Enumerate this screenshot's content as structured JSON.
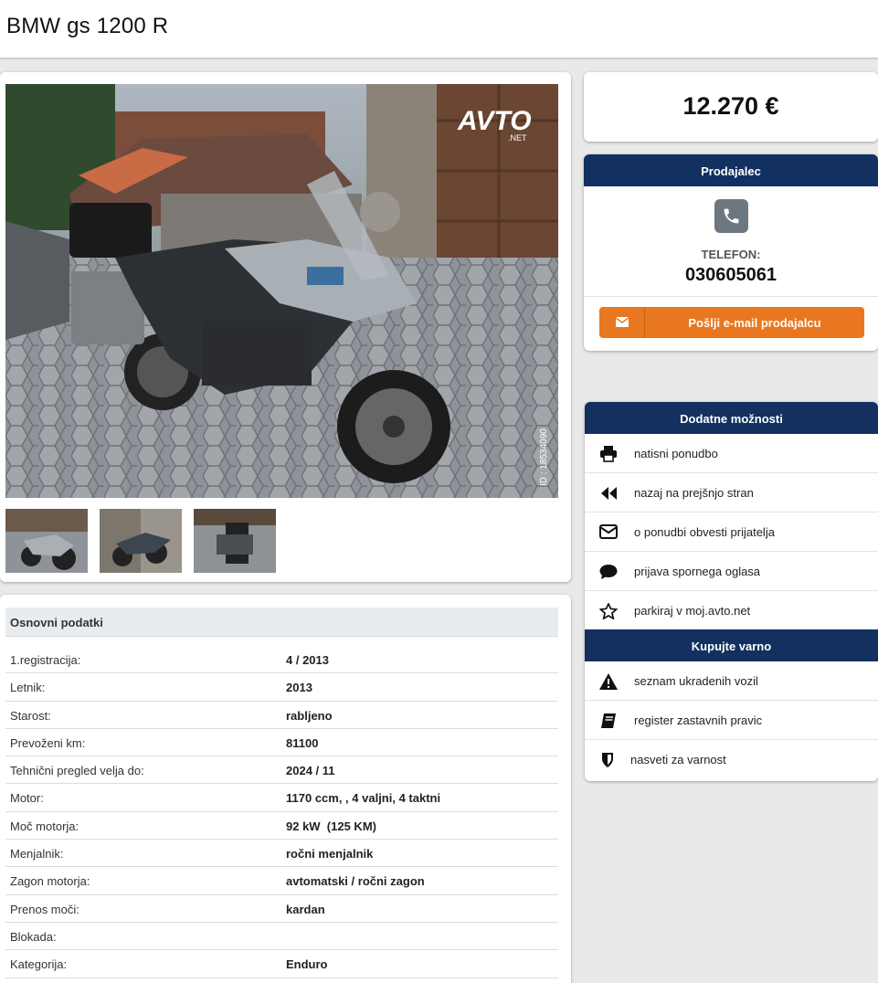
{
  "page": {
    "title": "BMW gs 1200 R"
  },
  "gallery": {
    "watermark_logo": "AVTO",
    "watermark_sub": ".NET",
    "photo_id": "ID : 18534090",
    "thumbnails": [
      "thumbnail 1",
      "thumbnail 2",
      "thumbnail 3"
    ]
  },
  "price": {
    "value": "12.270 €"
  },
  "seller": {
    "header": "Prodajalec",
    "phone_label": "TELEFON:",
    "phone_number": "030605061",
    "email_button": "Pošlji e-mail prodajalcu",
    "icons": {
      "phone": "phone-icon",
      "email": "envelope-icon"
    },
    "colors": {
      "header_bg": "#123160",
      "button_bg": "#e8771f",
      "phone_icon_bg": "#6d7780"
    }
  },
  "options": {
    "header": "Dodatne možnosti",
    "items": [
      {
        "label": "natisni ponudbo",
        "icon": "print-icon"
      },
      {
        "label": "nazaj na prejšnjo stran",
        "icon": "rewind-icon"
      },
      {
        "label": "o ponudbi obvesti prijatelja",
        "icon": "envelope-icon"
      },
      {
        "label": "prijava spornega oglasa",
        "icon": "comment-icon"
      },
      {
        "label": "parkiraj v moj.avto.net",
        "icon": "star-icon"
      }
    ],
    "safe_header": "Kupujte varno",
    "safe_items": [
      {
        "label": "seznam ukradenih vozil",
        "icon": "warning-icon"
      },
      {
        "label": "register zastavnih pravic",
        "icon": "book-icon"
      },
      {
        "label": "nasveti za varnost",
        "icon": "shield-icon"
      }
    ]
  },
  "specs": {
    "header": "Osnovni podatki",
    "rows": [
      {
        "label": "1.registracija:",
        "value": "4 / 2013"
      },
      {
        "label": "Letnik:",
        "value": "2013"
      },
      {
        "label": "Starost:",
        "value": "rabljeno"
      },
      {
        "label": "Prevoženi km:",
        "value": "81100"
      },
      {
        "label": "Tehnični pregled velja do:",
        "value": "2024 / 11"
      },
      {
        "label": "Motor:",
        "value": "1170 ccm, , 4 valjni, 4 taktni"
      },
      {
        "label": "Moč motorja:",
        "value": "92 kW  (125 KM)"
      },
      {
        "label": "Menjalnik:",
        "value": "ročni menjalnik"
      },
      {
        "label": "Zagon motorja:",
        "value": "avtomatski / ročni zagon"
      },
      {
        "label": "Prenos moči:",
        "value": "kardan"
      },
      {
        "label": "Blokada:",
        "value": ""
      },
      {
        "label": "Kategorija:",
        "value": "Enduro"
      }
    ]
  }
}
